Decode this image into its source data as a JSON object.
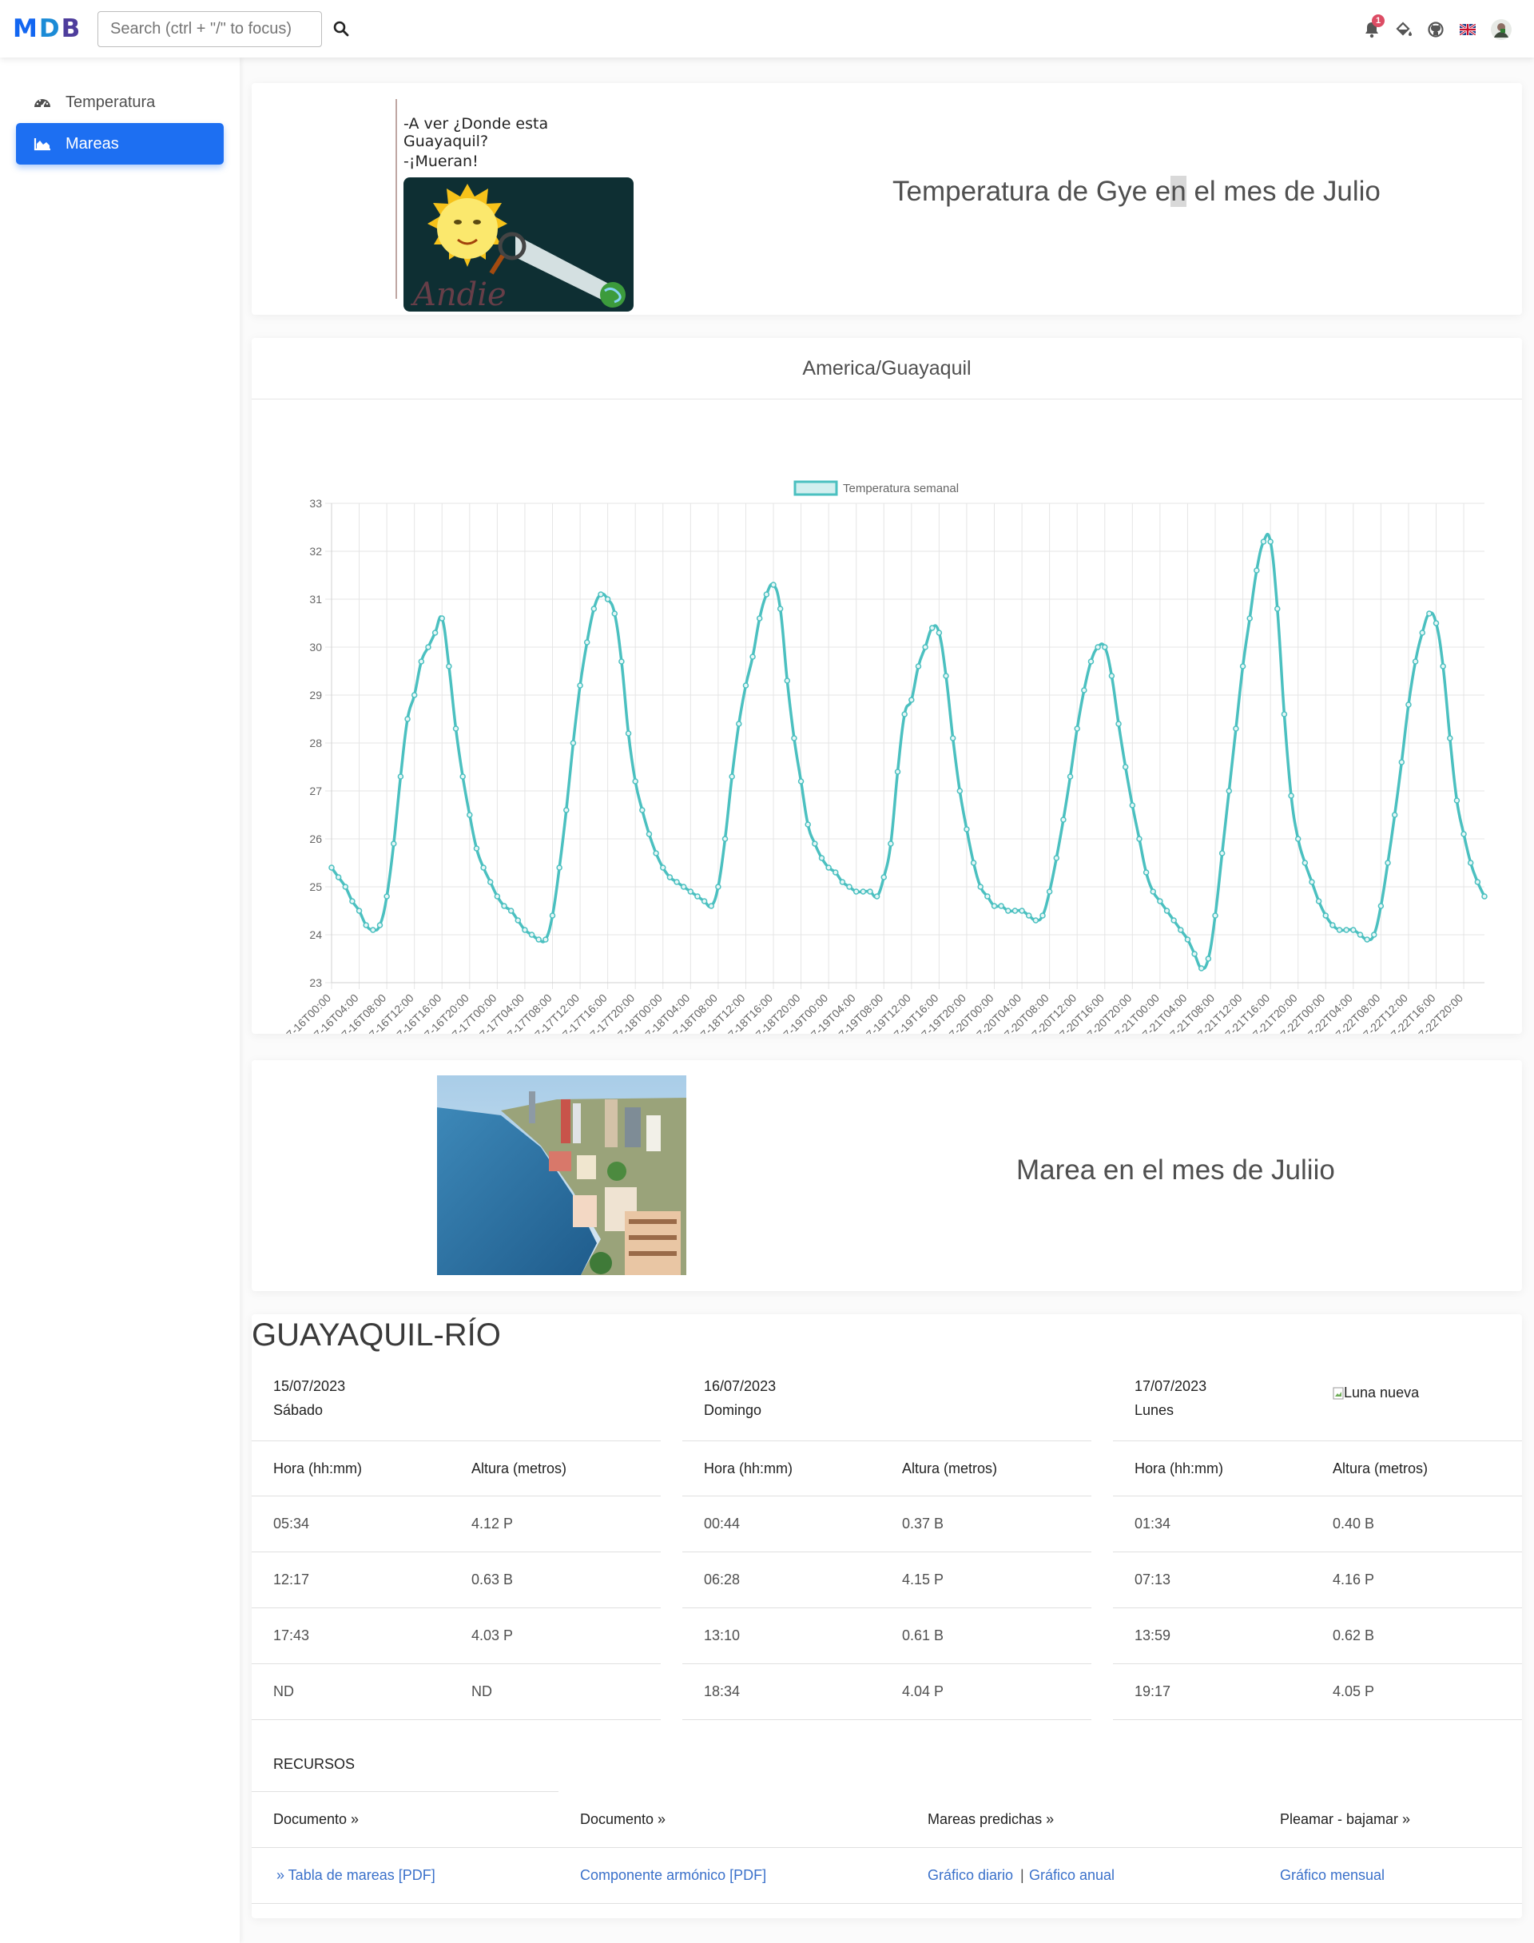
{
  "topbar": {
    "logo": "MDB",
    "search_placeholder": "Search (ctrl + \"/\" to focus)",
    "notification_count": "1",
    "logo_colors": [
      "#3b71ca",
      "#14a44d",
      "#3b71ca"
    ]
  },
  "sidebar": {
    "items": [
      {
        "label": "Temperatura",
        "icon": "gauge-icon",
        "active": false
      },
      {
        "label": "Mareas",
        "icon": "area-chart-icon",
        "active": true
      }
    ]
  },
  "intro": {
    "joke_line1": "-A ver ¿Donde esta Guayaquil?",
    "joke_line2": "-¡Mueran!",
    "joke_signature": "Andie",
    "heading_before": "Temperatura de Gye e",
    "heading_highlight": "n",
    "heading_after": " el mes de Julio"
  },
  "chart_card": {
    "title": "America/Guayaquil"
  },
  "chart_data": {
    "type": "line",
    "legend": "Temperatura semanal",
    "ylim": [
      23,
      33
    ],
    "yticks": [
      23,
      24,
      25,
      26,
      27,
      28,
      29,
      30,
      31,
      32,
      33
    ],
    "xlabels": [
      "2023-07-16T00:00",
      "2023-07-16T04:00",
      "2023-07-16T08:00",
      "2023-07-16T12:00",
      "2023-07-16T16:00",
      "2023-07-16T20:00",
      "2023-07-17T00:00",
      "2023-07-17T04:00",
      "2023-07-17T08:00",
      "2023-07-17T12:00",
      "2023-07-17T16:00",
      "2023-07-17T20:00",
      "2023-07-18T00:00",
      "2023-07-18T04:00",
      "2023-07-18T08:00",
      "2023-07-18T12:00",
      "2023-07-18T16:00",
      "2023-07-18T20:00",
      "2023-07-19T00:00",
      "2023-07-19T04:00",
      "2023-07-19T08:00",
      "2023-07-19T12:00",
      "2023-07-19T16:00",
      "2023-07-19T20:00",
      "2023-07-20T00:00",
      "2023-07-20T04:00",
      "2023-07-20T08:00",
      "2023-07-20T12:00",
      "2023-07-20T16:00",
      "2023-07-20T20:00",
      "2023-07-21T00:00",
      "2023-07-21T04:00",
      "2023-07-21T08:00",
      "2023-07-21T12:00",
      "2023-07-21T16:00",
      "2023-07-21T20:00",
      "2023-07-22T00:00",
      "2023-07-22T04:00",
      "2023-07-22T08:00",
      "2023-07-22T12:00",
      "2023-07-22T16:00",
      "2023-07-22T20:00"
    ],
    "values": [
      25.4,
      25.2,
      25.0,
      24.7,
      24.5,
      24.2,
      24.1,
      24.2,
      24.8,
      25.9,
      27.3,
      28.5,
      29.0,
      29.7,
      30.0,
      30.3,
      30.6,
      29.6,
      28.3,
      27.3,
      26.5,
      25.8,
      25.4,
      25.1,
      24.8,
      24.6,
      24.5,
      24.3,
      24.1,
      24.0,
      23.9,
      23.9,
      24.4,
      25.4,
      26.6,
      28.0,
      29.2,
      30.1,
      30.8,
      31.1,
      31.0,
      30.7,
      29.7,
      28.2,
      27.2,
      26.6,
      26.1,
      25.7,
      25.4,
      25.2,
      25.1,
      25.0,
      24.9,
      24.8,
      24.7,
      24.6,
      25.0,
      26.0,
      27.3,
      28.4,
      29.2,
      29.8,
      30.6,
      31.1,
      31.3,
      30.8,
      29.3,
      28.1,
      27.2,
      26.3,
      25.9,
      25.6,
      25.4,
      25.3,
      25.1,
      25.0,
      24.9,
      24.9,
      24.9,
      24.8,
      25.2,
      25.9,
      27.4,
      28.6,
      28.9,
      29.6,
      30.0,
      30.4,
      30.3,
      29.4,
      28.1,
      27.0,
      26.2,
      25.5,
      25.0,
      24.8,
      24.6,
      24.6,
      24.5,
      24.5,
      24.5,
      24.4,
      24.3,
      24.4,
      24.9,
      25.6,
      26.4,
      27.3,
      28.3,
      29.1,
      29.7,
      30.0,
      30.0,
      29.4,
      28.4,
      27.5,
      26.7,
      26.0,
      25.3,
      24.9,
      24.7,
      24.5,
      24.3,
      24.1,
      23.9,
      23.6,
      23.3,
      23.5,
      24.4,
      25.7,
      27.0,
      28.3,
      29.6,
      30.6,
      31.6,
      32.2,
      32.2,
      30.8,
      28.6,
      26.9,
      26.0,
      25.5,
      25.1,
      24.7,
      24.4,
      24.2,
      24.1,
      24.1,
      24.1,
      24.0,
      23.9,
      24.0,
      24.6,
      25.5,
      26.5,
      27.6,
      28.8,
      29.7,
      30.3,
      30.7,
      30.5,
      29.6,
      28.1,
      26.8,
      26.1,
      25.5,
      25.1,
      24.8
    ],
    "color": "#4bc0c0"
  },
  "marea": {
    "heading": "Marea en el mes de Juliio"
  },
  "tides": {
    "title": "GUAYAQUIL-RÍO",
    "col_hour": "Hora (hh:mm)",
    "col_height": "Altura (metros)",
    "moon_alt": "Luna nueva",
    "days": [
      {
        "date": "15/07/2023",
        "day": "Sábado",
        "rows": [
          [
            "05:34",
            "4.12 P"
          ],
          [
            "12:17",
            "0.63 B"
          ],
          [
            "17:43",
            "4.03 P"
          ],
          [
            "ND",
            "ND"
          ]
        ]
      },
      {
        "date": "16/07/2023",
        "day": "Domingo",
        "rows": [
          [
            "00:44",
            "0.37 B"
          ],
          [
            "06:28",
            "4.15 P"
          ],
          [
            "13:10",
            "0.61 B"
          ],
          [
            "18:34",
            "4.04 P"
          ]
        ]
      },
      {
        "date": "17/07/2023",
        "day": "Lunes",
        "rows": [
          [
            "01:34",
            "0.40 B"
          ],
          [
            "07:13",
            "4.16 P"
          ],
          [
            "13:59",
            "0.62 B"
          ],
          [
            "19:17",
            "4.05 P"
          ]
        ]
      }
    ]
  },
  "resources": {
    "title": "RECURSOS",
    "headers": [
      "Documento »",
      "Documento »",
      "Mareas predichas »",
      "Pleamar - bajamar »"
    ],
    "link1": "» Tabla de mareas [PDF]",
    "link2": "Componente armónico [PDF]",
    "link3a": "Gráfico diario",
    "link3sep": "|",
    "link3b": "Gráfico anual",
    "link4": "Gráfico mensual"
  }
}
